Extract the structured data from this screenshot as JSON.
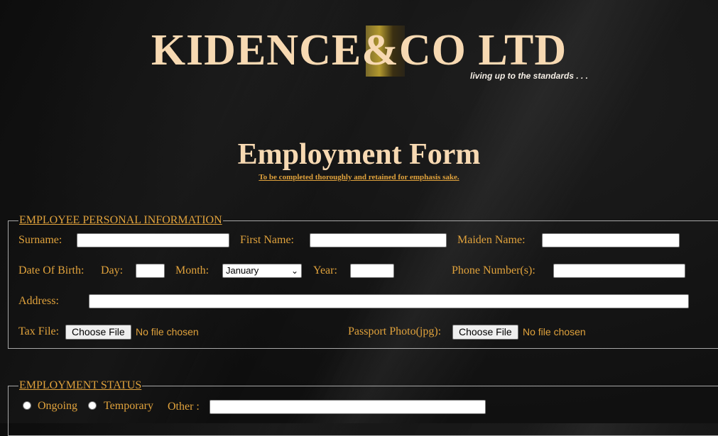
{
  "header": {
    "logo_text": "KIDENCE&CO LTD",
    "tagline": "living up to the standards . . ."
  },
  "form": {
    "title": "Employment Form",
    "subtitle": "To be completed thoroughly and retained for emphasis sake."
  },
  "personal": {
    "legend": "EMPLOYEE PERSONAL INFORMATION",
    "surname_label": "Surname:",
    "surname_value": "",
    "first_name_label": "First Name:",
    "first_name_value": "",
    "maiden_name_label": "Maiden Name:",
    "maiden_name_value": "",
    "dob_label": "Date Of Birth:",
    "day_label": "Day:",
    "month_label": "Month:",
    "month_selected": "January",
    "year_label": "Year:",
    "phone_label": "Phone Number(s):",
    "address_label": "Address:",
    "tax_file_label": "Tax File:",
    "passport_label": "Passport Photo(jpg):",
    "choose_file": "Choose File",
    "no_file": "No file chosen"
  },
  "status": {
    "legend": "EMPLOYMENT STATUS",
    "ongoing": "Ongoing",
    "temporary": "Temporary",
    "other_label": "Other :"
  }
}
